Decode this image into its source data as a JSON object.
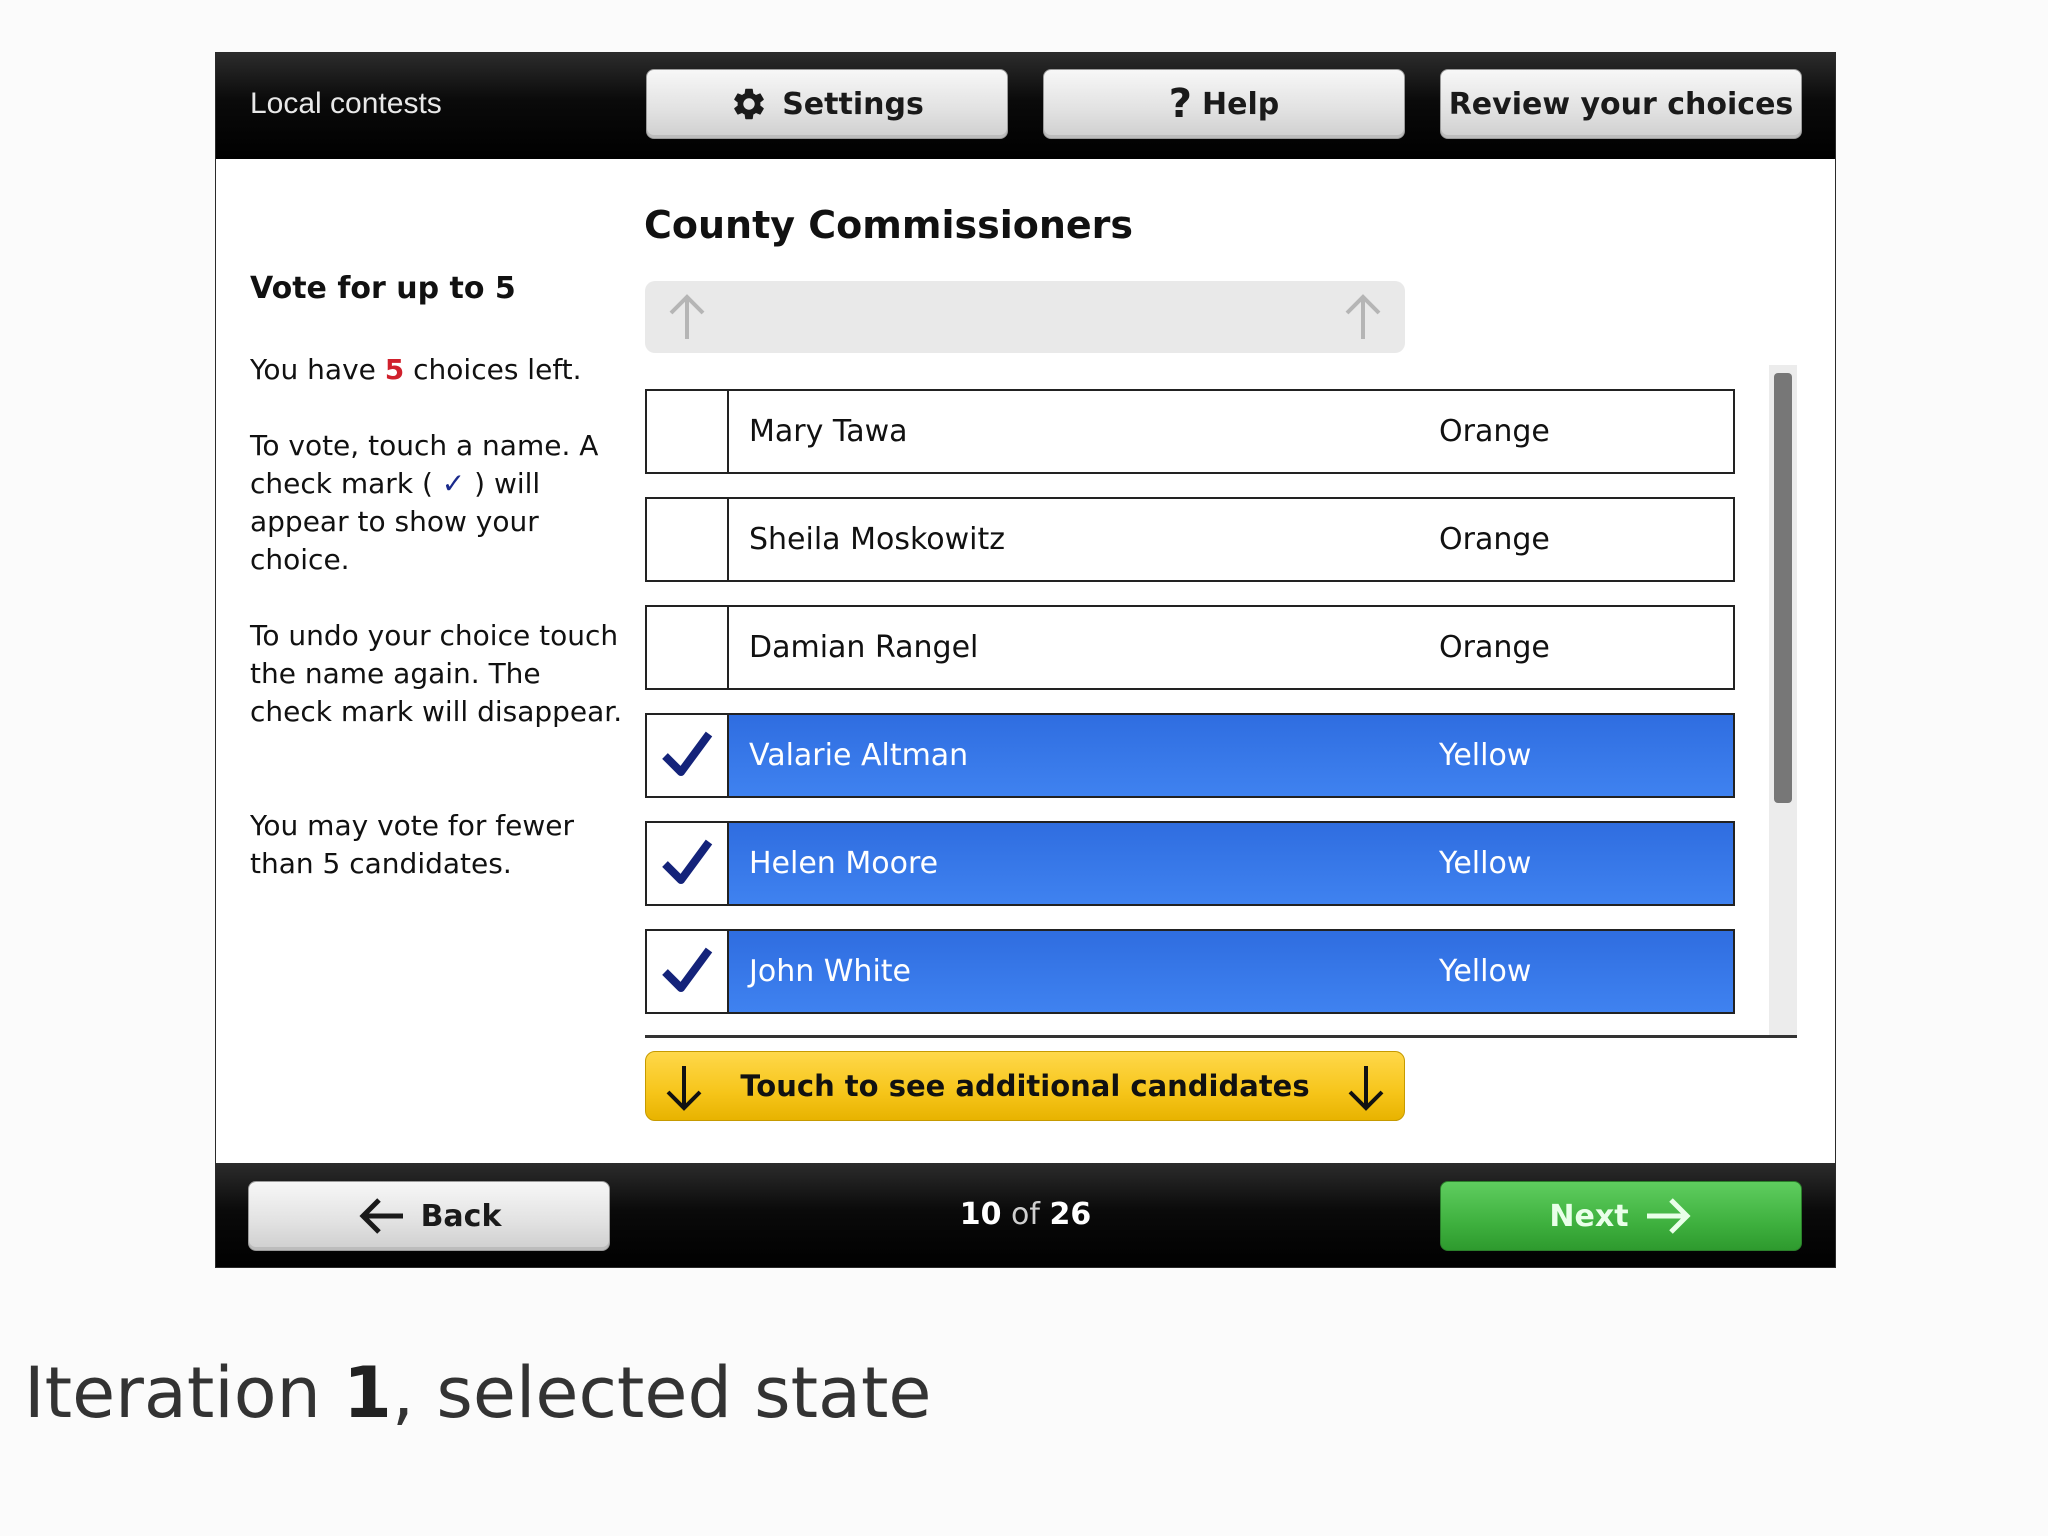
{
  "header": {
    "section_title": "Local contests",
    "settings_label": "Settings",
    "help_label": "Help",
    "review_label": "Review your choices"
  },
  "instructions": {
    "vote_limit": "Vote for up to 5",
    "choices_prefix": "You have ",
    "choices_left": "5",
    "choices_suffix": " choices left.",
    "how_to_vote_a": "To vote, touch a name. A check mark ( ",
    "check_glyph": "✓",
    "how_to_vote_b": " ) will appear to show your choice.",
    "undo": "To undo your choice touch the name again. The check mark will disappear.",
    "fewer": "You may vote for fewer than 5 candidates."
  },
  "contest": {
    "title": "County Commissioners",
    "more_label": "Touch to see additional candidates",
    "candidates": [
      {
        "name": "Mary Tawa",
        "party": "Orange",
        "selected": false
      },
      {
        "name": "Sheila Moskowitz",
        "party": "Orange",
        "selected": false
      },
      {
        "name": "Damian Rangel",
        "party": "Orange",
        "selected": false
      },
      {
        "name": "Valarie Altman",
        "party": "Yellow",
        "selected": true
      },
      {
        "name": "Helen Moore",
        "party": "Yellow",
        "selected": true
      },
      {
        "name": "John White",
        "party": "Yellow",
        "selected": true
      }
    ]
  },
  "footer": {
    "back_label": "Back",
    "page_current": "10",
    "page_of": " of ",
    "page_total": "26",
    "next_label": "Next"
  },
  "caption": {
    "prefix": "Iteration ",
    "number": "1",
    "suffix": ", selected state"
  },
  "colors": {
    "selected_row": "#3f82f0",
    "next_button": "#3fb13f",
    "more_button": "#f6c51a",
    "checkmark": "#1a2a8c",
    "choices_count": "#d0202c"
  },
  "icons": {
    "settings": "gear-icon",
    "help": "question-icon",
    "back": "arrow-left-icon",
    "next": "arrow-right-icon",
    "scroll_up": "arrow-up-icon",
    "scroll_down": "arrow-down-icon",
    "selected": "checkmark-icon"
  }
}
